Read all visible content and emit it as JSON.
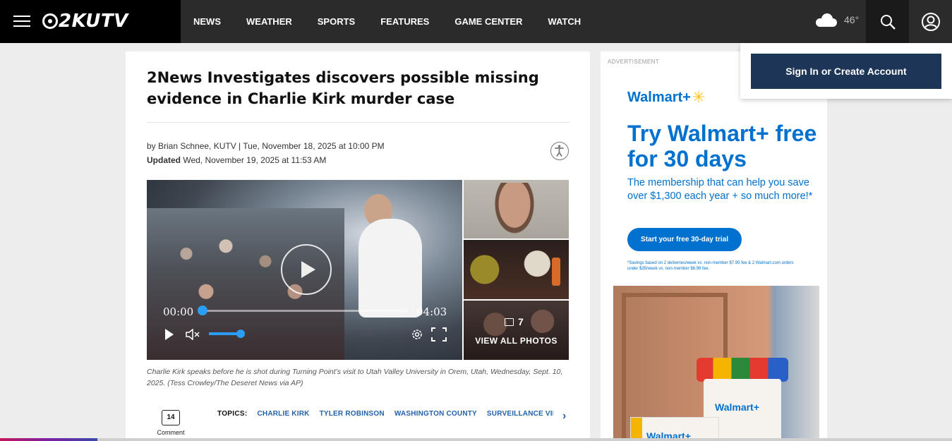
{
  "header": {
    "brand": "2KUTV",
    "nav": [
      "NEWS",
      "WEATHER",
      "SPORTS",
      "FEATURES",
      "GAME CENTER",
      "WATCH"
    ],
    "weather": {
      "icon": "cloud-icon",
      "temp": "46°"
    },
    "icons": {
      "menu": "hamburger-menu-icon",
      "search": "search-icon",
      "account": "user-account-icon"
    }
  },
  "account_dropdown": {
    "signin_label": "Sign In or Create Account"
  },
  "article": {
    "headline": "2News Investigates discovers possible missing evidence in Charlie Kirk murder case",
    "byline": "by Brian Schnee, KUTV | Tue, November 18, 2025 at 10:00 PM",
    "updated_label": "Updated",
    "updated_time": "Wed, November 19, 2025 at 11:53 AM",
    "video": {
      "current_time": "00:00",
      "duration": "04:03"
    },
    "gallery": {
      "photo_count": "7",
      "view_all_label": "VIEW ALL PHOTOS"
    },
    "caption": "Charlie Kirk speaks before he is shot during Turning Point's visit to Utah Valley University in Orem, Utah, Wednesday, Sept. 10, 2025. (Tess Crowley/The Deseret News via AP)",
    "comments": {
      "count": "14",
      "label": "Comment"
    },
    "topics_label": "TOPICS:",
    "topics": [
      "CHARLIE KIRK",
      "TYLER ROBINSON",
      "WASHINGTON COUNTY",
      "SURVEILLANCE VIDEO"
    ]
  },
  "ad": {
    "label": "ADVERTISEMENT",
    "logo": "Walmart+",
    "headline": "Try Walmart+ free for 30 days",
    "subtext": "The membership that can help you save over $1,300 each year + so much more!*",
    "cta": "Start your free 30-day trial",
    "fine_print": "*Savings based on 2 deliveries/week vs. non-member $7.95 fee & 2 Walmart.com orders under $35/week vs. non-member $6.99 fee.",
    "bag_text": "Walmart+",
    "box_text": "Walmart+"
  },
  "colors": {
    "walmart_blue": "#0071ce",
    "walmart_yellow": "#ffc220",
    "topic_blue": "#2462a8",
    "signin_navy": "#1d3557"
  }
}
